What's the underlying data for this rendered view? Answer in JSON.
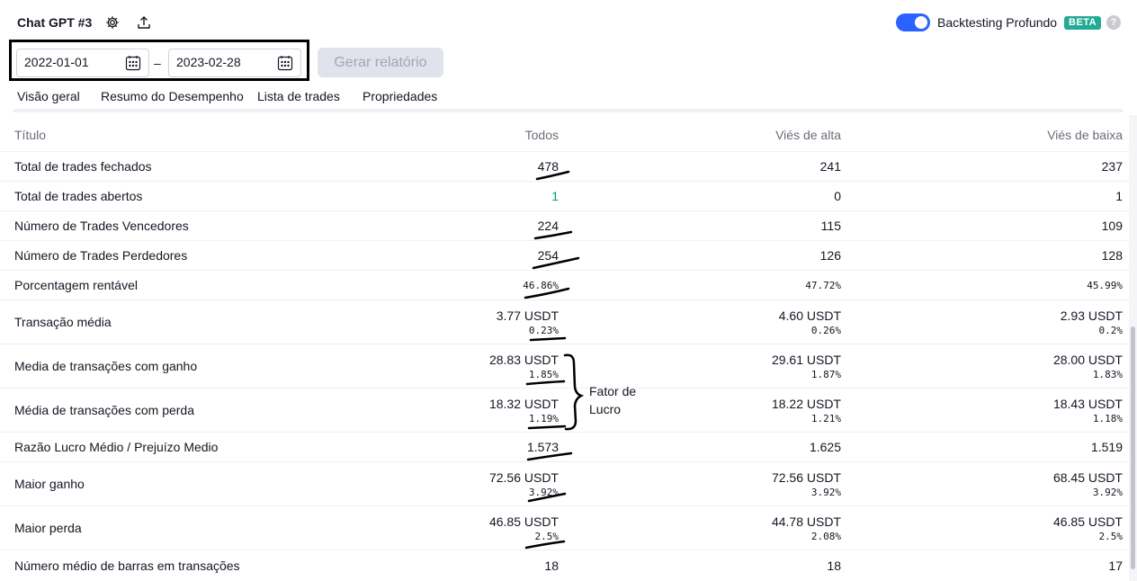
{
  "header": {
    "strategy_name": "Chat GPT #3",
    "deep_backtesting_label": "Backtesting Profundo",
    "beta_badge": "BETA",
    "help_symbol": "?",
    "deep_backtesting_enabled": true
  },
  "date_range": {
    "start": "2022-01-01",
    "separator": "–",
    "end": "2023-02-28",
    "generate_button": "Gerar relatório"
  },
  "tabs": [
    {
      "label": "Visão geral",
      "active": false
    },
    {
      "label": "Resumo do Desempenho",
      "active": true
    },
    {
      "label": "Lista de trades",
      "active": false
    },
    {
      "label": "Propriedades",
      "active": false
    }
  ],
  "table": {
    "headers": {
      "title": "Título",
      "all": "Todos",
      "long": "Viés de alta",
      "short": "Viés de baixa"
    },
    "rows": [
      {
        "title": "Total de trades fechados",
        "all": "478",
        "long": "241",
        "short": "237"
      },
      {
        "title": "Total de trades abertos",
        "all": "1",
        "long": "0",
        "short": "1"
      },
      {
        "title": "Número de Trades Vencedores",
        "all": "224",
        "long": "115",
        "short": "109"
      },
      {
        "title": "Número de Trades Perdedores",
        "all": "254",
        "long": "126",
        "short": "128"
      },
      {
        "title": "Porcentagem rentável",
        "all": "46.86%",
        "long": "47.72%",
        "short": "45.99%"
      },
      {
        "title": "Transação média",
        "all": "3.77 USDT",
        "all_sub": "0.23%",
        "long": "4.60 USDT",
        "long_sub": "0.26%",
        "short": "2.93 USDT",
        "short_sub": "0.2%"
      },
      {
        "title": "Media de transações com ganho",
        "all": "28.83 USDT",
        "all_sub": "1.85%",
        "long": "29.61 USDT",
        "long_sub": "1.87%",
        "short": "28.00 USDT",
        "short_sub": "1.83%"
      },
      {
        "title": "Média de transações com perda",
        "all": "18.32 USDT",
        "all_sub": "1.19%",
        "long": "18.22 USDT",
        "long_sub": "1.21%",
        "short": "18.43 USDT",
        "short_sub": "1.18%"
      },
      {
        "title": "Razão Lucro Médio / Prejuízo Medio",
        "all": "1.573",
        "long": "1.625",
        "short": "1.519"
      },
      {
        "title": "Maior ganho",
        "all": "72.56 USDT",
        "all_sub": "3.92%",
        "long": "72.56 USDT",
        "long_sub": "3.92%",
        "short": "68.45 USDT",
        "short_sub": "3.92%"
      },
      {
        "title": "Maior perda",
        "all": "46.85 USDT",
        "all_sub": "2.5%",
        "long": "44.78 USDT",
        "long_sub": "2.08%",
        "short": "46.85 USDT",
        "short_sub": "2.5%"
      },
      {
        "title": "Número médio de barras em transações",
        "all": "18",
        "long": "18",
        "short": "17"
      }
    ]
  },
  "annotation": {
    "line1": "Fator de",
    "line2": "Lucro"
  },
  "colors": {
    "accent": "#2962ff",
    "beta": "#22ab94",
    "positive": "#089981",
    "text": "#131722",
    "muted": "#6a6d78"
  }
}
